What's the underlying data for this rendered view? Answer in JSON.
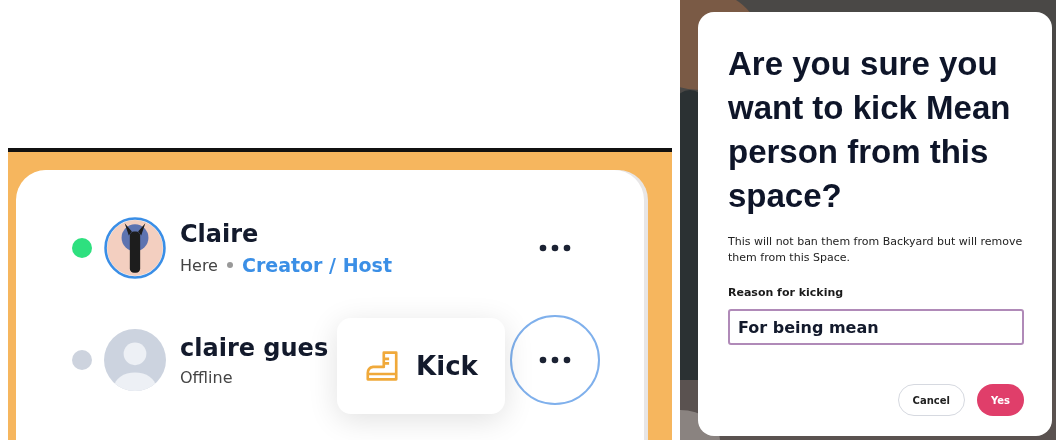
{
  "members": [
    {
      "name": "Claire",
      "online": true,
      "kind": "picture",
      "status": "Here",
      "role": "Creator / Host",
      "menu_open": false
    },
    {
      "name": "claire gues",
      "online": false,
      "kind": "default",
      "status": "Offline",
      "menu_open": true
    }
  ],
  "member_menu": {
    "items": [
      {
        "label": "Kick",
        "kind": "kick"
      }
    ]
  },
  "dialog": {
    "title": "Are you sure you want to kick Mean person from this space?",
    "description": "This will not ban them from Backyard but will remove them from this Space.",
    "field": {
      "label": "Reason for kicking",
      "value": "For being mean"
    },
    "buttons": [
      {
        "label": "Cancel",
        "kind": "secondary"
      },
      {
        "label": "Yes",
        "kind": "primary"
      }
    ]
  }
}
